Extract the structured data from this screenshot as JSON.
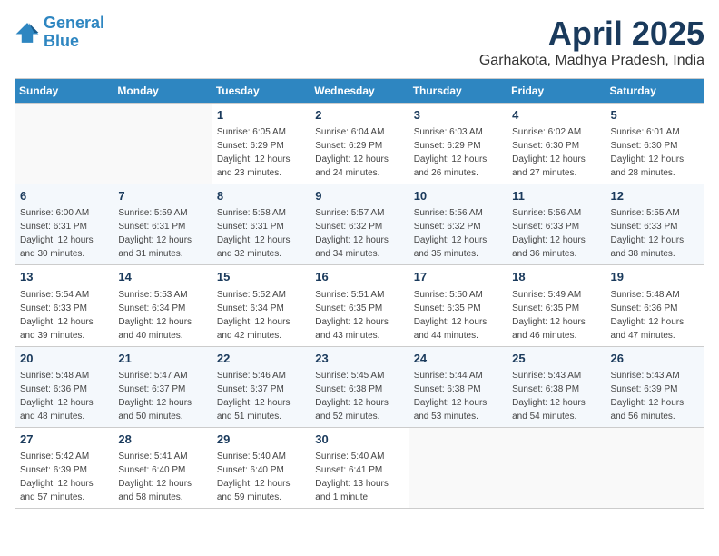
{
  "header": {
    "logo_line1": "General",
    "logo_line2": "Blue",
    "month": "April 2025",
    "location": "Garhakota, Madhya Pradesh, India"
  },
  "weekdays": [
    "Sunday",
    "Monday",
    "Tuesday",
    "Wednesday",
    "Thursday",
    "Friday",
    "Saturday"
  ],
  "weeks": [
    [
      {
        "day": "",
        "info": ""
      },
      {
        "day": "",
        "info": ""
      },
      {
        "day": "1",
        "info": "Sunrise: 6:05 AM\nSunset: 6:29 PM\nDaylight: 12 hours and 23 minutes."
      },
      {
        "day": "2",
        "info": "Sunrise: 6:04 AM\nSunset: 6:29 PM\nDaylight: 12 hours and 24 minutes."
      },
      {
        "day": "3",
        "info": "Sunrise: 6:03 AM\nSunset: 6:29 PM\nDaylight: 12 hours and 26 minutes."
      },
      {
        "day": "4",
        "info": "Sunrise: 6:02 AM\nSunset: 6:30 PM\nDaylight: 12 hours and 27 minutes."
      },
      {
        "day": "5",
        "info": "Sunrise: 6:01 AM\nSunset: 6:30 PM\nDaylight: 12 hours and 28 minutes."
      }
    ],
    [
      {
        "day": "6",
        "info": "Sunrise: 6:00 AM\nSunset: 6:31 PM\nDaylight: 12 hours and 30 minutes."
      },
      {
        "day": "7",
        "info": "Sunrise: 5:59 AM\nSunset: 6:31 PM\nDaylight: 12 hours and 31 minutes."
      },
      {
        "day": "8",
        "info": "Sunrise: 5:58 AM\nSunset: 6:31 PM\nDaylight: 12 hours and 32 minutes."
      },
      {
        "day": "9",
        "info": "Sunrise: 5:57 AM\nSunset: 6:32 PM\nDaylight: 12 hours and 34 minutes."
      },
      {
        "day": "10",
        "info": "Sunrise: 5:56 AM\nSunset: 6:32 PM\nDaylight: 12 hours and 35 minutes."
      },
      {
        "day": "11",
        "info": "Sunrise: 5:56 AM\nSunset: 6:33 PM\nDaylight: 12 hours and 36 minutes."
      },
      {
        "day": "12",
        "info": "Sunrise: 5:55 AM\nSunset: 6:33 PM\nDaylight: 12 hours and 38 minutes."
      }
    ],
    [
      {
        "day": "13",
        "info": "Sunrise: 5:54 AM\nSunset: 6:33 PM\nDaylight: 12 hours and 39 minutes."
      },
      {
        "day": "14",
        "info": "Sunrise: 5:53 AM\nSunset: 6:34 PM\nDaylight: 12 hours and 40 minutes."
      },
      {
        "day": "15",
        "info": "Sunrise: 5:52 AM\nSunset: 6:34 PM\nDaylight: 12 hours and 42 minutes."
      },
      {
        "day": "16",
        "info": "Sunrise: 5:51 AM\nSunset: 6:35 PM\nDaylight: 12 hours and 43 minutes."
      },
      {
        "day": "17",
        "info": "Sunrise: 5:50 AM\nSunset: 6:35 PM\nDaylight: 12 hours and 44 minutes."
      },
      {
        "day": "18",
        "info": "Sunrise: 5:49 AM\nSunset: 6:35 PM\nDaylight: 12 hours and 46 minutes."
      },
      {
        "day": "19",
        "info": "Sunrise: 5:48 AM\nSunset: 6:36 PM\nDaylight: 12 hours and 47 minutes."
      }
    ],
    [
      {
        "day": "20",
        "info": "Sunrise: 5:48 AM\nSunset: 6:36 PM\nDaylight: 12 hours and 48 minutes."
      },
      {
        "day": "21",
        "info": "Sunrise: 5:47 AM\nSunset: 6:37 PM\nDaylight: 12 hours and 50 minutes."
      },
      {
        "day": "22",
        "info": "Sunrise: 5:46 AM\nSunset: 6:37 PM\nDaylight: 12 hours and 51 minutes."
      },
      {
        "day": "23",
        "info": "Sunrise: 5:45 AM\nSunset: 6:38 PM\nDaylight: 12 hours and 52 minutes."
      },
      {
        "day": "24",
        "info": "Sunrise: 5:44 AM\nSunset: 6:38 PM\nDaylight: 12 hours and 53 minutes."
      },
      {
        "day": "25",
        "info": "Sunrise: 5:43 AM\nSunset: 6:38 PM\nDaylight: 12 hours and 54 minutes."
      },
      {
        "day": "26",
        "info": "Sunrise: 5:43 AM\nSunset: 6:39 PM\nDaylight: 12 hours and 56 minutes."
      }
    ],
    [
      {
        "day": "27",
        "info": "Sunrise: 5:42 AM\nSunset: 6:39 PM\nDaylight: 12 hours and 57 minutes."
      },
      {
        "day": "28",
        "info": "Sunrise: 5:41 AM\nSunset: 6:40 PM\nDaylight: 12 hours and 58 minutes."
      },
      {
        "day": "29",
        "info": "Sunrise: 5:40 AM\nSunset: 6:40 PM\nDaylight: 12 hours and 59 minutes."
      },
      {
        "day": "30",
        "info": "Sunrise: 5:40 AM\nSunset: 6:41 PM\nDaylight: 13 hours and 1 minute."
      },
      {
        "day": "",
        "info": ""
      },
      {
        "day": "",
        "info": ""
      },
      {
        "day": "",
        "info": ""
      }
    ]
  ]
}
